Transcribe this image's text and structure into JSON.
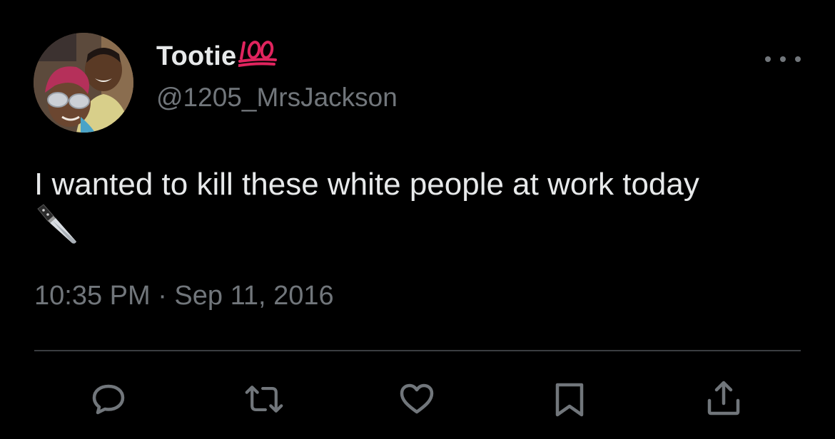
{
  "tweet": {
    "display_name": "Tootie",
    "name_emoji": "hundred-points-emoji",
    "handle": "@1205_MrsJackson",
    "text": "I wanted to kill these white people at work today",
    "text_emoji": "kitchen-knife-emoji",
    "timestamp": "10:35 PM · Sep 11, 2016"
  },
  "actions": [
    {
      "name": "reply",
      "icon": "reply-icon"
    },
    {
      "name": "retweet",
      "icon": "retweet-icon"
    },
    {
      "name": "like",
      "icon": "heart-icon"
    },
    {
      "name": "bookmark",
      "icon": "bookmark-icon"
    },
    {
      "name": "share",
      "icon": "share-icon"
    }
  ],
  "colors": {
    "background": "#000000",
    "primary_text": "#e7e9ea",
    "secondary_text": "#71767b",
    "divider": "#3a3d41",
    "hundred_emoji": "#e0245e"
  }
}
